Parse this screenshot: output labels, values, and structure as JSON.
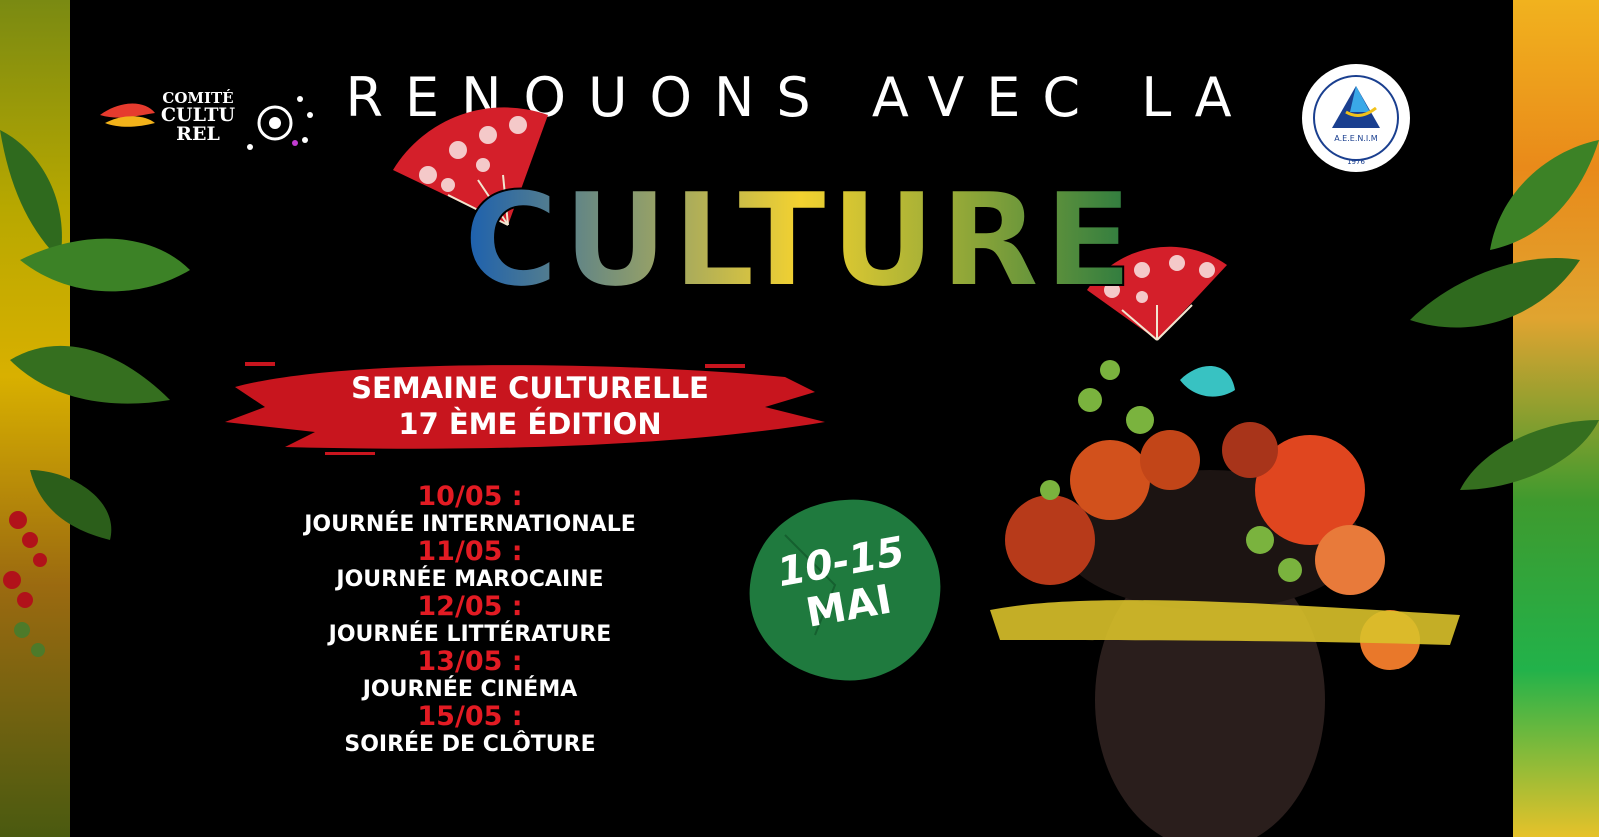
{
  "headline": "RENOUONS AVEC LA",
  "culture_word": "CULTURE",
  "edition": {
    "line1": "SEMAINE CULTURELLE",
    "line2": "17 ÈME ÉDITION"
  },
  "schedule": [
    {
      "date": "10/05 :",
      "name": "JOURNÉE INTERNATIONALE"
    },
    {
      "date": "11/05 :",
      "name": "JOURNÉE MAROCAINE"
    },
    {
      "date": "12/05 :",
      "name": "JOURNÉE LITTÉRATURE"
    },
    {
      "date": "13/05 :",
      "name": "JOURNÉE CINÉMA"
    },
    {
      "date": "15/05 :",
      "name": "SOIRÉE DE CLÔTURE"
    }
  ],
  "badge": {
    "dates": "10-15",
    "month": "MAI"
  },
  "logo_left": {
    "line1": "COMITÉ",
    "line2": "CULTU",
    "line3": "REL"
  },
  "logo_right": {
    "name": "A.E.E.N.I.M",
    "year": "1976"
  },
  "colors": {
    "background": "#000000",
    "accent_red": "#e31b23",
    "badge_green": "#1f7a3e",
    "text": "#ffffff"
  }
}
